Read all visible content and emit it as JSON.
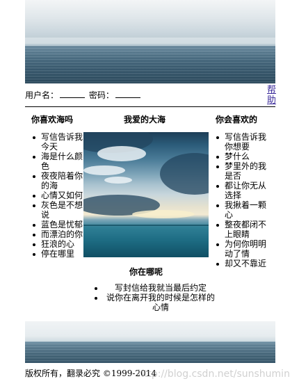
{
  "login": {
    "username_label": "用户名：",
    "password_label": "密码："
  },
  "help_link": "帮助",
  "titles": {
    "left": "你喜欢海吗",
    "center": "我爱的大海",
    "right": "你会喜欢的",
    "where": "你在哪呢"
  },
  "left_list": [
    "写信告诉我今天",
    "海是什么颜色",
    "夜夜陪着你的海",
    "心情又如何",
    "灰色是不想说",
    "蓝色是忧郁",
    "而漂泊的你",
    "狂浪的心",
    "停在哪里"
  ],
  "right_list": [
    "写信告诉我你想要",
    "梦什么",
    "梦里外的我是否",
    "都让你无从选择",
    "我揪着一颗心",
    "整夜都闭不上眼睛",
    "为何你明明动了情",
    "却又不靠近"
  ],
  "center_list": [
    "写封信给我就当最后约定",
    "说你在离开我的时候是怎样的心情"
  ],
  "footer": "版权所有，翻录必究 ©1999-2014",
  "watermark": "http://blog.csdn.net/sunshumin"
}
